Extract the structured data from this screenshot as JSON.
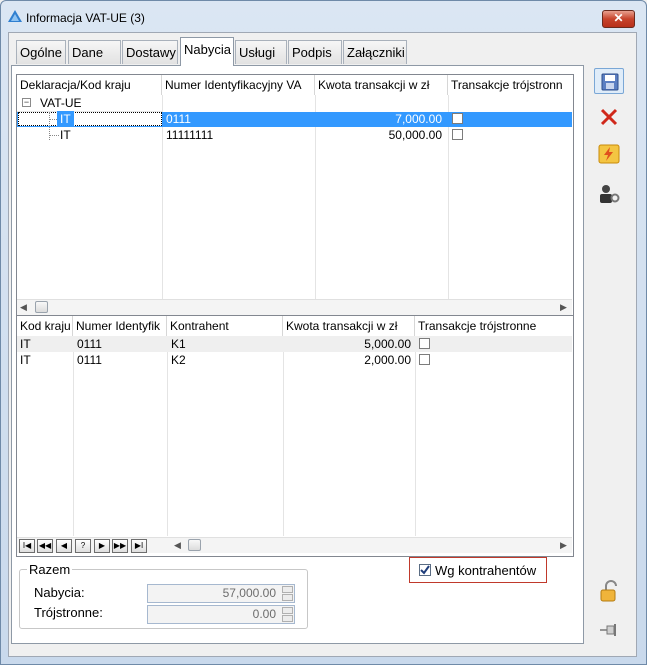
{
  "window": {
    "title": "Informacja VAT-UE (3)",
    "close_glyph": "✕"
  },
  "tabs": [
    {
      "label": "Ogólne"
    },
    {
      "label": "Dane"
    },
    {
      "label": "Dostawy"
    },
    {
      "label": "Nabycia"
    },
    {
      "label": "Usługi"
    },
    {
      "label": "Podpis"
    },
    {
      "label": "Załączniki"
    }
  ],
  "active_tab": "Nabycia",
  "upper_grid": {
    "columns": [
      "Deklaracja/Kod kraju",
      "Numer Identyfikacyjny VA",
      "Kwota transakcji w zł",
      "Transakcje trójstronn"
    ],
    "group_toggle": "⊟",
    "group_label": "VAT-UE",
    "rows": [
      {
        "kod": "IT",
        "numer": "0111",
        "kwota": "7,000.00",
        "trojstronne": false,
        "selected": true
      },
      {
        "kod": "IT",
        "numer": "11111111",
        "kwota": "50,000.00",
        "trojstronne": false,
        "selected": false
      }
    ]
  },
  "lower_grid": {
    "columns": [
      "Kod kraju",
      "Numer Identyfik",
      "Kontrahent",
      "Kwota transakcji w zł",
      "Transakcje trójstronne"
    ],
    "rows": [
      {
        "kod": "IT",
        "numer": "0111",
        "kontrahent": "K1",
        "kwota": "5,000.00",
        "trojstronne": false
      },
      {
        "kod": "IT",
        "numer": "0111",
        "kontrahent": "K2",
        "kwota": "2,000.00",
        "trojstronne": false
      }
    ],
    "nav_buttons": [
      "I◀",
      "◀◀",
      "◀",
      "?",
      "▶",
      "▶▶",
      "▶I"
    ]
  },
  "razem": {
    "legend": "Razem",
    "nabycia_label": "Nabycia:",
    "nabycia_value": "57,000.00",
    "trojstronne_label": "Trójstronne:",
    "trojstronne_value": "0.00"
  },
  "wg_kontrahentow": {
    "label": "Wg kontrahentów",
    "checked": true
  },
  "colors": {
    "selection": "#3399ff",
    "highlight_border": "#c0392b"
  },
  "toolbar_icons": [
    "save-icon",
    "delete-icon",
    "lightning-icon",
    "user-settings-icon",
    "lock-icon",
    "pin-icon"
  ]
}
